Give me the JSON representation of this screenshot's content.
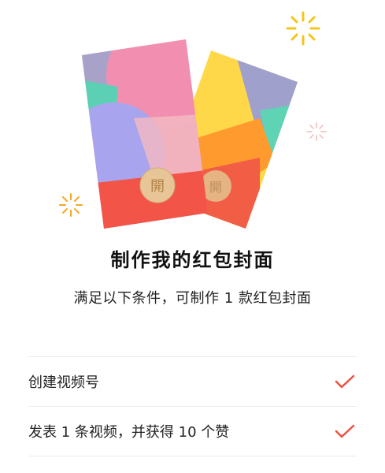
{
  "title": "制作我的红包封面",
  "subtitle": "满足以下条件，可制作 1 款红包封面",
  "envelope_seal": "開",
  "conditions": [
    {
      "label": "创建视频号",
      "status": "check-icon"
    },
    {
      "label": "发表 1 条视频，并获得 10 个赞",
      "status": "check-icon"
    }
  ],
  "colors": {
    "accent_red": "#f05040",
    "spark_yellow": "#f5c518",
    "spark_orange": "#f5a623",
    "spark_pink": "#f2b8b8"
  }
}
